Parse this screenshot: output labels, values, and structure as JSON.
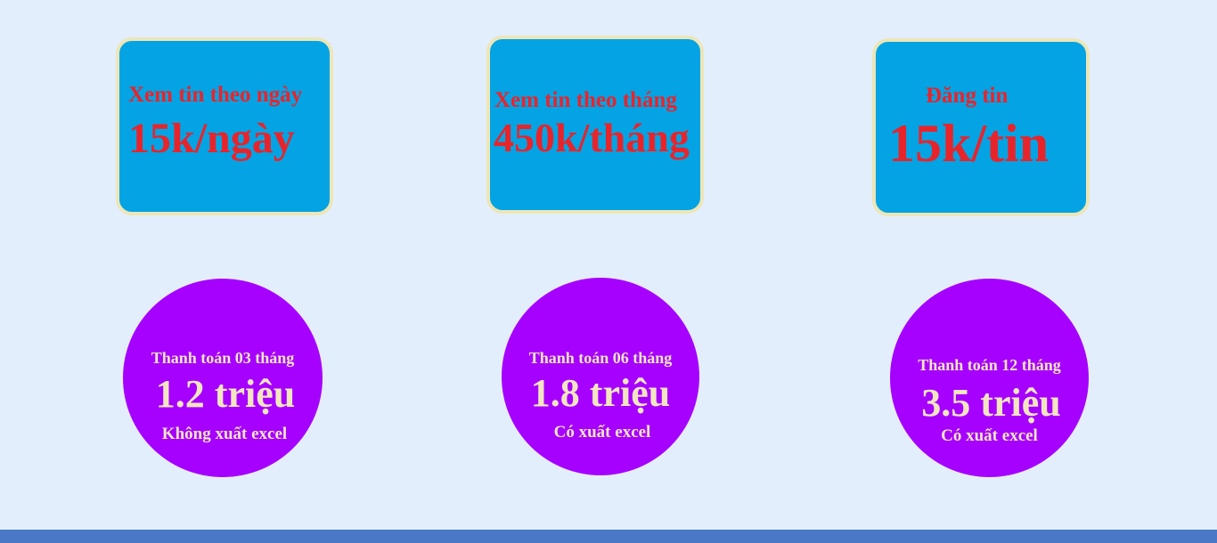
{
  "cards": [
    {
      "title": "Xem tin theo ngày",
      "price": "15k/ngày"
    },
    {
      "title": "Xem tin theo tháng",
      "price": "450k/tháng"
    },
    {
      "title": "Đăng tin",
      "price": "15k/tin"
    }
  ],
  "plans": [
    {
      "label": "Thanh toán 03 tháng",
      "price": "1.2 triệu",
      "note": "Không xuất excel"
    },
    {
      "label": "Thanh toán 06 tháng",
      "price": "1.8 triệu",
      "note": "Có xuất excel"
    },
    {
      "label": "Thanh toán 12 tháng",
      "price": "3.5 triệu",
      "note": "Có xuất excel"
    }
  ],
  "colors": {
    "page_background": "#e3eefc",
    "card_fill": "#04a3e3",
    "card_border": "#ece6b8",
    "card_text": "#e8242b",
    "circle_fill": "#a600ff",
    "circle_text": "#f3e6bf",
    "footer_bar": "#4a78c6"
  }
}
